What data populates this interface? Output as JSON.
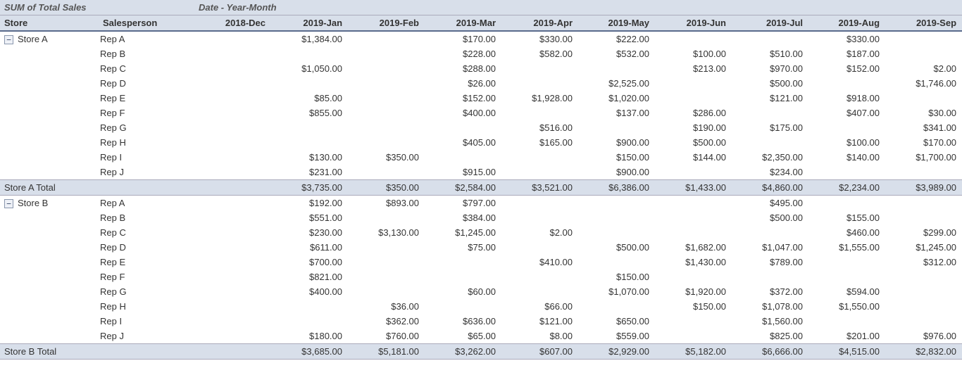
{
  "header": {
    "measure_label": "SUM of Total Sales",
    "col_group_label": "Date - Year-Month",
    "row_dim1": "Store",
    "row_dim2": "Salesperson"
  },
  "months": [
    "2018-Dec",
    "2019-Jan",
    "2019-Feb",
    "2019-Mar",
    "2019-Apr",
    "2019-May",
    "2019-Jun",
    "2019-Jul",
    "2019-Aug",
    "2019-Sep"
  ],
  "stores": [
    {
      "name": "Store A",
      "total_label": "Store A Total",
      "reps": [
        {
          "name": "Rep A",
          "values": [
            "",
            "$1,384.00",
            "",
            "$170.00",
            "$330.00",
            "$222.00",
            "",
            "",
            "$330.00",
            ""
          ]
        },
        {
          "name": "Rep B",
          "values": [
            "",
            "",
            "",
            "$228.00",
            "$582.00",
            "$532.00",
            "$100.00",
            "$510.00",
            "$187.00",
            ""
          ]
        },
        {
          "name": "Rep C",
          "values": [
            "",
            "$1,050.00",
            "",
            "$288.00",
            "",
            "",
            "$213.00",
            "$970.00",
            "$152.00",
            "$2.00"
          ]
        },
        {
          "name": "Rep D",
          "values": [
            "",
            "",
            "",
            "$26.00",
            "",
            "$2,525.00",
            "",
            "$500.00",
            "",
            "$1,746.00"
          ]
        },
        {
          "name": "Rep E",
          "values": [
            "",
            "$85.00",
            "",
            "$152.00",
            "$1,928.00",
            "$1,020.00",
            "",
            "$121.00",
            "$918.00",
            ""
          ]
        },
        {
          "name": "Rep F",
          "values": [
            "",
            "$855.00",
            "",
            "$400.00",
            "",
            "$137.00",
            "$286.00",
            "",
            "$407.00",
            "$30.00"
          ]
        },
        {
          "name": "Rep G",
          "values": [
            "",
            "",
            "",
            "",
            "$516.00",
            "",
            "$190.00",
            "$175.00",
            "",
            "$341.00"
          ]
        },
        {
          "name": "Rep H",
          "values": [
            "",
            "",
            "",
            "$405.00",
            "$165.00",
            "$900.00",
            "$500.00",
            "",
            "$100.00",
            "$170.00"
          ]
        },
        {
          "name": "Rep I",
          "values": [
            "",
            "$130.00",
            "$350.00",
            "",
            "",
            "$150.00",
            "$144.00",
            "$2,350.00",
            "$140.00",
            "$1,700.00"
          ]
        },
        {
          "name": "Rep J",
          "values": [
            "",
            "$231.00",
            "",
            "$915.00",
            "",
            "$900.00",
            "",
            "$234.00",
            "",
            ""
          ]
        }
      ],
      "totals": [
        "",
        "$3,735.00",
        "$350.00",
        "$2,584.00",
        "$3,521.00",
        "$6,386.00",
        "$1,433.00",
        "$4,860.00",
        "$2,234.00",
        "$3,989.00"
      ]
    },
    {
      "name": "Store B",
      "total_label": "Store B Total",
      "reps": [
        {
          "name": "Rep A",
          "values": [
            "",
            "$192.00",
            "$893.00",
            "$797.00",
            "",
            "",
            "",
            "$495.00",
            "",
            ""
          ]
        },
        {
          "name": "Rep B",
          "values": [
            "",
            "$551.00",
            "",
            "$384.00",
            "",
            "",
            "",
            "$500.00",
            "$155.00",
            ""
          ]
        },
        {
          "name": "Rep C",
          "values": [
            "",
            "$230.00",
            "$3,130.00",
            "$1,245.00",
            "$2.00",
            "",
            "",
            "",
            "$460.00",
            "$299.00"
          ]
        },
        {
          "name": "Rep D",
          "values": [
            "",
            "$611.00",
            "",
            "$75.00",
            "",
            "$500.00",
            "$1,682.00",
            "$1,047.00",
            "$1,555.00",
            "$1,245.00"
          ]
        },
        {
          "name": "Rep E",
          "values": [
            "",
            "$700.00",
            "",
            "",
            "$410.00",
            "",
            "$1,430.00",
            "$789.00",
            "",
            "$312.00"
          ]
        },
        {
          "name": "Rep F",
          "values": [
            "",
            "$821.00",
            "",
            "",
            "",
            "$150.00",
            "",
            "",
            "",
            ""
          ]
        },
        {
          "name": "Rep G",
          "values": [
            "",
            "$400.00",
            "",
            "$60.00",
            "",
            "$1,070.00",
            "$1,920.00",
            "$372.00",
            "$594.00",
            ""
          ]
        },
        {
          "name": "Rep H",
          "values": [
            "",
            "",
            "$36.00",
            "",
            "$66.00",
            "",
            "$150.00",
            "$1,078.00",
            "$1,550.00",
            ""
          ]
        },
        {
          "name": "Rep I",
          "values": [
            "",
            "",
            "$362.00",
            "$636.00",
            "$121.00",
            "$650.00",
            "",
            "$1,560.00",
            "",
            ""
          ]
        },
        {
          "name": "Rep J",
          "values": [
            "",
            "$180.00",
            "$760.00",
            "$65.00",
            "$8.00",
            "$559.00",
            "",
            "$825.00",
            "$201.00",
            "$976.00"
          ]
        }
      ],
      "totals": [
        "",
        "$3,685.00",
        "$5,181.00",
        "$3,262.00",
        "$607.00",
        "$2,929.00",
        "$5,182.00",
        "$6,666.00",
        "$4,515.00",
        "$2,832.00"
      ]
    }
  ]
}
